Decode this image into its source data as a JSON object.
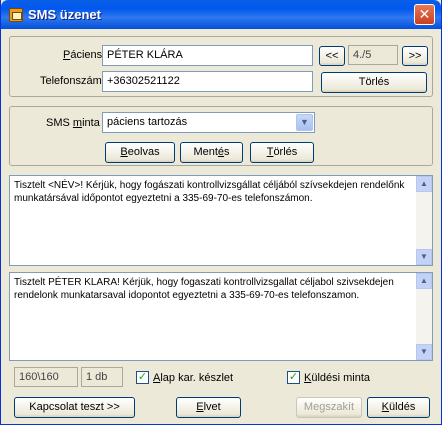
{
  "window": {
    "title": "SMS üzenet",
    "close_label": "✕"
  },
  "patient": {
    "label_pre": "",
    "label_ul": "P",
    "label_post": "áciens",
    "name": "PÉTER KLÁRA",
    "prev_label": "<<",
    "next_label": ">>",
    "counter": "4./5"
  },
  "phone": {
    "label": "Telefonszám",
    "value": "+36302521122",
    "delete_label": "Törlés"
  },
  "template": {
    "label_pre": "SMS ",
    "label_ul": "m",
    "label_post": "inta",
    "selected": "páciens tartozás",
    "load_ul": "B",
    "load_rest": "eolvas",
    "save_pre": "Ment",
    "save_ul": "é",
    "save_post": "s",
    "delete_ul": "T",
    "delete_rest": "örlés"
  },
  "template_text": "Tisztelt <NÉV>! Kérjük, hogy fogászati kontrollvizsgállat céljából szívsekdejen rendelőnk munkatársával időpontot egyeztetni a 335-69-70-es telefonszámon.",
  "preview_text": "Tisztelt PÉTER KLARA! Kérjük, hogy fogaszati kontrollvizsgallat céljabol szivsekdejen rendelonk munkatarsaval idopontot egyeztetni a 335-69-70-es telefonszamon.",
  "status": {
    "char_count": "160\\160",
    "sms_count": "1 db",
    "base_charset_check": "✓",
    "base_charset_ul": "A",
    "base_charset_rest": "lap kar. készlet",
    "send_template_check": "✓",
    "send_template_ul": "K",
    "send_template_rest": "üldési minta"
  },
  "footer": {
    "test_label": "Kapcsolat teszt >>",
    "send_away_ul": "E",
    "send_away_rest": "lvet",
    "abort_label": "Megszakít",
    "send_ul": "K",
    "send_rest": "üldés"
  }
}
